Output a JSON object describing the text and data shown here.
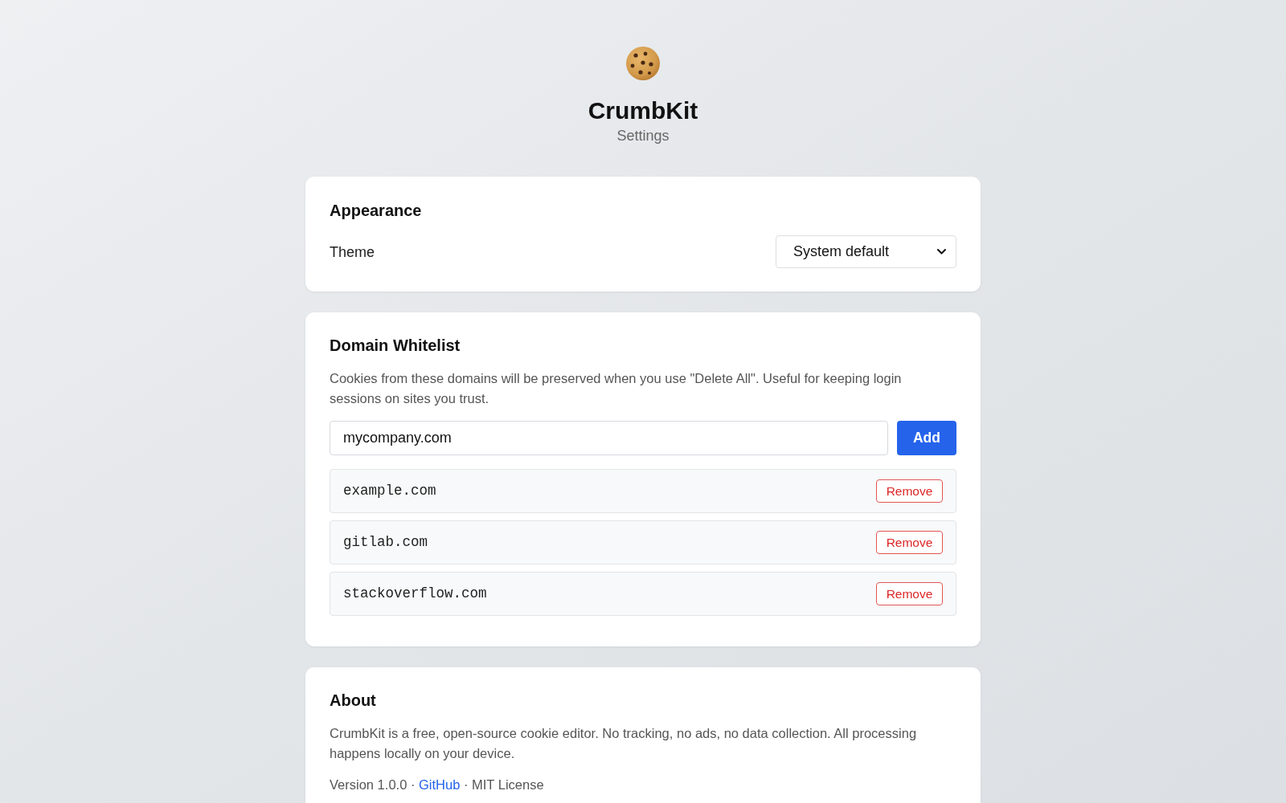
{
  "header": {
    "title": "CrumbKit",
    "subtitle": "Settings"
  },
  "appearance": {
    "title": "Appearance",
    "theme": {
      "label": "Theme",
      "value": "System default"
    }
  },
  "whitelist": {
    "title": "Domain Whitelist",
    "description": "Cookies from these domains will be preserved when you use \"Delete All\". Useful for keeping login sessions on sites you trust.",
    "input": {
      "value": "mycompany.com"
    },
    "add_button": "Add",
    "domains": [
      {
        "name": "example.com",
        "remove_button": "Remove"
      },
      {
        "name": "gitlab.com",
        "remove_button": "Remove"
      },
      {
        "name": "stackoverflow.com",
        "remove_button": "Remove"
      }
    ]
  },
  "about": {
    "title": "About",
    "description": "CrumbKit is a free, open-source cookie editor. No tracking, no ads, no data collection. All processing happens locally on your device.",
    "footer": [
      {
        "kind": "text",
        "text": "Version 1.0.0 · "
      },
      {
        "kind": "link",
        "text": "GitHub"
      },
      {
        "kind": "text",
        "text": " · MIT License"
      }
    ]
  }
}
